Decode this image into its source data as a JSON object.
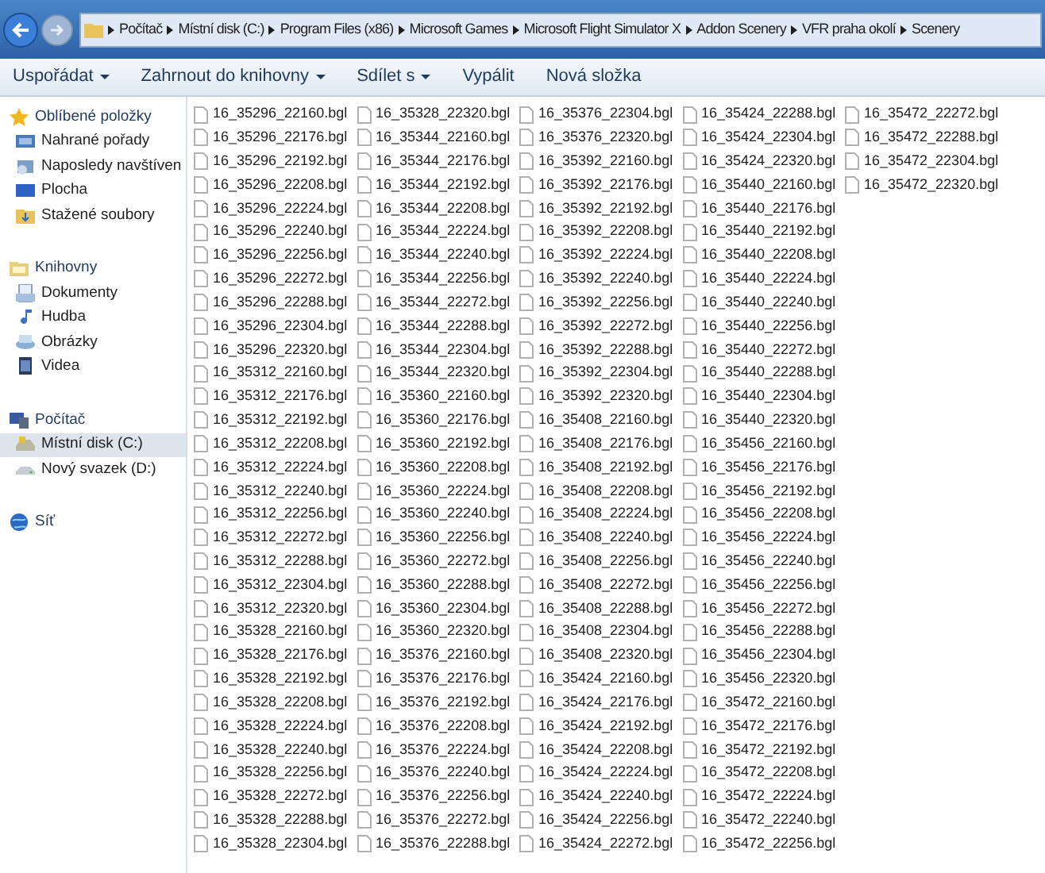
{
  "address_bar": {
    "path": [
      "Počítač",
      "Místní disk (C:)",
      "Program Files (x86)",
      "Microsoft Games",
      "Microsoft Flight Simulator X",
      "Addon Scenery",
      "VFR praha okolí",
      "Scenery"
    ]
  },
  "toolbar": [
    {
      "label": "Uspořádat",
      "dropdown": true
    },
    {
      "label": "Zahrnout do knihovny",
      "dropdown": true
    },
    {
      "label": "Sdílet s",
      "dropdown": true
    },
    {
      "label": "Vypálit",
      "dropdown": false
    },
    {
      "label": "Nová složka",
      "dropdown": false
    }
  ],
  "sidebar": [
    {
      "label": "Oblíbené položky",
      "kind": "star",
      "selected": false,
      "children": [
        {
          "label": "Nahrané pořady",
          "kind": "media",
          "selected": false
        },
        {
          "label": "Naposledy navštíven",
          "kind": "recent",
          "selected": false
        },
        {
          "label": "Plocha",
          "kind": "desktop",
          "selected": false
        },
        {
          "label": "Stažené soubory",
          "kind": "download",
          "selected": false
        }
      ]
    },
    {
      "label": "Knihovny",
      "kind": "library",
      "selected": false,
      "children": [
        {
          "label": "Dokumenty",
          "kind": "document",
          "selected": false
        },
        {
          "label": "Hudba",
          "kind": "music",
          "selected": false
        },
        {
          "label": "Obrázky",
          "kind": "picture",
          "selected": false
        },
        {
          "label": "Videa",
          "kind": "video",
          "selected": false
        }
      ]
    },
    {
      "label": "Počítač",
      "kind": "computer",
      "selected": false,
      "children": [
        {
          "label": "Místní disk (C:)",
          "kind": "drive",
          "selected": true
        },
        {
          "label": "Nový svazek (D:)",
          "kind": "drive2",
          "selected": false
        }
      ]
    },
    {
      "label": "Síť",
      "kind": "network",
      "selected": false
    }
  ],
  "files": [
    "16_35296_22160.bgl",
    "16_35296_22176.bgl",
    "16_35296_22192.bgl",
    "16_35296_22208.bgl",
    "16_35296_22224.bgl",
    "16_35296_22240.bgl",
    "16_35296_22256.bgl",
    "16_35296_22272.bgl",
    "16_35296_22288.bgl",
    "16_35296_22304.bgl",
    "16_35296_22320.bgl",
    "16_35312_22160.bgl",
    "16_35312_22176.bgl",
    "16_35312_22192.bgl",
    "16_35312_22208.bgl",
    "16_35312_22224.bgl",
    "16_35312_22240.bgl",
    "16_35312_22256.bgl",
    "16_35312_22272.bgl",
    "16_35312_22288.bgl",
    "16_35312_22304.bgl",
    "16_35312_22320.bgl",
    "16_35328_22160.bgl",
    "16_35328_22176.bgl",
    "16_35328_22192.bgl",
    "16_35328_22208.bgl",
    "16_35328_22224.bgl",
    "16_35328_22240.bgl",
    "16_35328_22256.bgl",
    "16_35328_22272.bgl",
    "16_35328_22288.bgl",
    "16_35328_22304.bgl",
    "16_35328_22320.bgl",
    "16_35344_22160.bgl",
    "16_35344_22176.bgl",
    "16_35344_22192.bgl",
    "16_35344_22208.bgl",
    "16_35344_22224.bgl",
    "16_35344_22240.bgl",
    "16_35344_22256.bgl",
    "16_35344_22272.bgl",
    "16_35344_22288.bgl",
    "16_35344_22304.bgl",
    "16_35344_22320.bgl",
    "16_35360_22160.bgl",
    "16_35360_22176.bgl",
    "16_35360_22192.bgl",
    "16_35360_22208.bgl",
    "16_35360_22224.bgl",
    "16_35360_22240.bgl",
    "16_35360_22256.bgl",
    "16_35360_22272.bgl",
    "16_35360_22288.bgl",
    "16_35360_22304.bgl",
    "16_35360_22320.bgl",
    "16_35376_22160.bgl",
    "16_35376_22176.bgl",
    "16_35376_22192.bgl",
    "16_35376_22208.bgl",
    "16_35376_22224.bgl",
    "16_35376_22240.bgl",
    "16_35376_22256.bgl",
    "16_35376_22272.bgl",
    "16_35376_22288.bgl",
    "16_35376_22304.bgl",
    "16_35376_22320.bgl",
    "16_35392_22160.bgl",
    "16_35392_22176.bgl",
    "16_35392_22192.bgl",
    "16_35392_22208.bgl",
    "16_35392_22224.bgl",
    "16_35392_22240.bgl",
    "16_35392_22256.bgl",
    "16_35392_22272.bgl",
    "16_35392_22288.bgl",
    "16_35392_22304.bgl",
    "16_35392_22320.bgl",
    "16_35408_22160.bgl",
    "16_35408_22176.bgl",
    "16_35408_22192.bgl",
    "16_35408_22208.bgl",
    "16_35408_22224.bgl",
    "16_35408_22240.bgl",
    "16_35408_22256.bgl",
    "16_35408_22272.bgl",
    "16_35408_22288.bgl",
    "16_35408_22304.bgl",
    "16_35408_22320.bgl",
    "16_35424_22160.bgl",
    "16_35424_22176.bgl",
    "16_35424_22192.bgl",
    "16_35424_22208.bgl",
    "16_35424_22224.bgl",
    "16_35424_22240.bgl",
    "16_35424_22256.bgl",
    "16_35424_22272.bgl",
    "16_35424_22288.bgl",
    "16_35424_22304.bgl",
    "16_35424_22320.bgl",
    "16_35440_22160.bgl",
    "16_35440_22176.bgl",
    "16_35440_22192.bgl",
    "16_35440_22208.bgl",
    "16_35440_22224.bgl",
    "16_35440_22240.bgl",
    "16_35440_22256.bgl",
    "16_35440_22272.bgl",
    "16_35440_22288.bgl",
    "16_35440_22304.bgl",
    "16_35440_22320.bgl",
    "16_35456_22160.bgl",
    "16_35456_22176.bgl",
    "16_35456_22192.bgl",
    "16_35456_22208.bgl",
    "16_35456_22224.bgl",
    "16_35456_22240.bgl",
    "16_35456_22256.bgl",
    "16_35456_22272.bgl",
    "16_35456_22288.bgl",
    "16_35456_22304.bgl",
    "16_35456_22320.bgl",
    "16_35472_22160.bgl",
    "16_35472_22176.bgl",
    "16_35472_22192.bgl",
    "16_35472_22208.bgl",
    "16_35472_22224.bgl",
    "16_35472_22240.bgl",
    "16_35472_22256.bgl",
    "16_35472_22272.bgl",
    "16_35472_22288.bgl",
    "16_35472_22304.bgl",
    "16_35472_22320.bgl"
  ]
}
